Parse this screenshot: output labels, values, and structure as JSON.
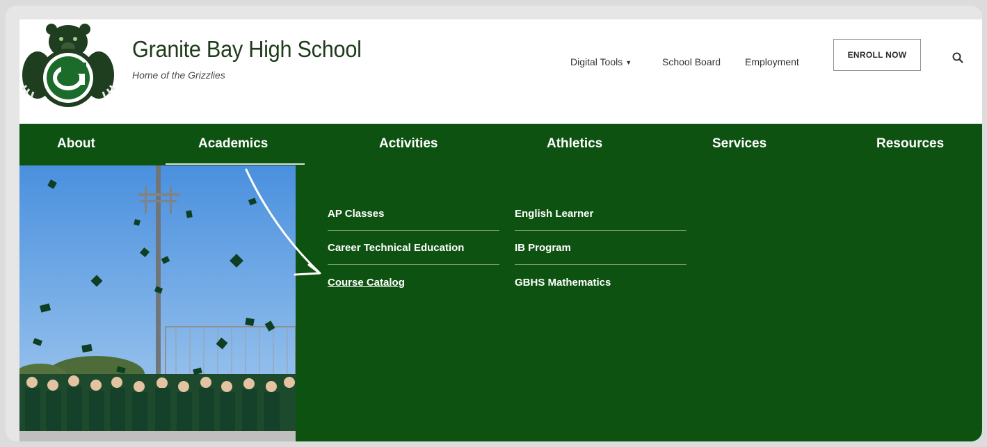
{
  "school": {
    "name": "Granite Bay High School",
    "tagline": "Home of the Grizzlies",
    "logo_letter": "G"
  },
  "utility_nav": {
    "digital_tools": "Digital Tools",
    "school_board": "School Board",
    "employment": "Employment",
    "enroll": "ENROLL NOW"
  },
  "main_nav": [
    {
      "label": "About"
    },
    {
      "label": "Academics"
    },
    {
      "label": "Activities"
    },
    {
      "label": "Athletics"
    },
    {
      "label": "Services"
    },
    {
      "label": "Resources"
    }
  ],
  "active_nav": "Academics",
  "academics_menu": {
    "column1": [
      "AP Classes",
      "Career Technical Education",
      "Course Catalog"
    ],
    "column2": [
      "English Learner",
      "IB Program",
      "GBHS Mathematics"
    ],
    "highlighted": "Course Catalog"
  },
  "colors": {
    "nav_green": "#0d5210",
    "logo_green": "#1b6b2a",
    "text_dark": "#1e3b1a"
  },
  "icons": {
    "search": "search-icon",
    "dropdown": "chevron-down-icon",
    "annotation": "curved-arrow-icon"
  }
}
